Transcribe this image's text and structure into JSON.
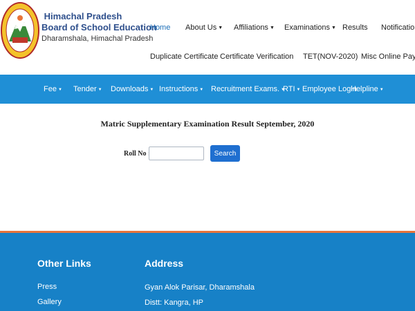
{
  "header": {
    "org_line1": "Himachal Pradesh",
    "org_line2": "Board of School Education",
    "org_line3": "Dharamshala, Himachal Pradesh",
    "logo_text": "BOARD OF SCHOOL EDUCATION HIMACHAL PRADESH",
    "nav_row1": [
      {
        "label": "Home",
        "active": true
      },
      {
        "label": "About Us",
        "dropdown": true
      },
      {
        "label": "Affiliations",
        "dropdown": true
      },
      {
        "label": "Examinations",
        "dropdown": true
      },
      {
        "label": "Results"
      },
      {
        "label": "Notifications"
      }
    ],
    "nav_row2": [
      {
        "label": "Duplicate Certificate"
      },
      {
        "label": "Certificate Verification"
      },
      {
        "label": "TET(NOV-2020)"
      },
      {
        "label": "Misc Online Payment"
      }
    ]
  },
  "menubar": {
    "items": [
      {
        "label": "Fee",
        "dropdown": true
      },
      {
        "label": "Tender",
        "dropdown": true
      },
      {
        "label": "Downloads",
        "dropdown": true
      },
      {
        "label": "Instructions",
        "dropdown": true
      },
      {
        "label": "Recruitment Exams.",
        "dropdown": true
      },
      {
        "label": "RTI",
        "dropdown": true
      },
      {
        "label": "Employee Login"
      },
      {
        "label": "Helpline",
        "dropdown": true
      }
    ]
  },
  "main": {
    "title": "Matric Supplementary Examination Result September, 2020",
    "roll_label": "Roll No :",
    "roll_value": "",
    "search_label": "Search"
  },
  "footer": {
    "other_links_heading": "Other Links",
    "links": [
      "Press",
      "Gallery"
    ],
    "address_heading": "Address",
    "address_lines": [
      "Gyan Alok Parisar, Dharamshala",
      "Distt: Kangra, HP"
    ]
  },
  "colors": {
    "menubar": "#1f8fd6",
    "footer": "#1781c7",
    "accent_line": "#e8743b",
    "org_text": "#2e4f8c",
    "search_button": "#1f6fd0"
  }
}
